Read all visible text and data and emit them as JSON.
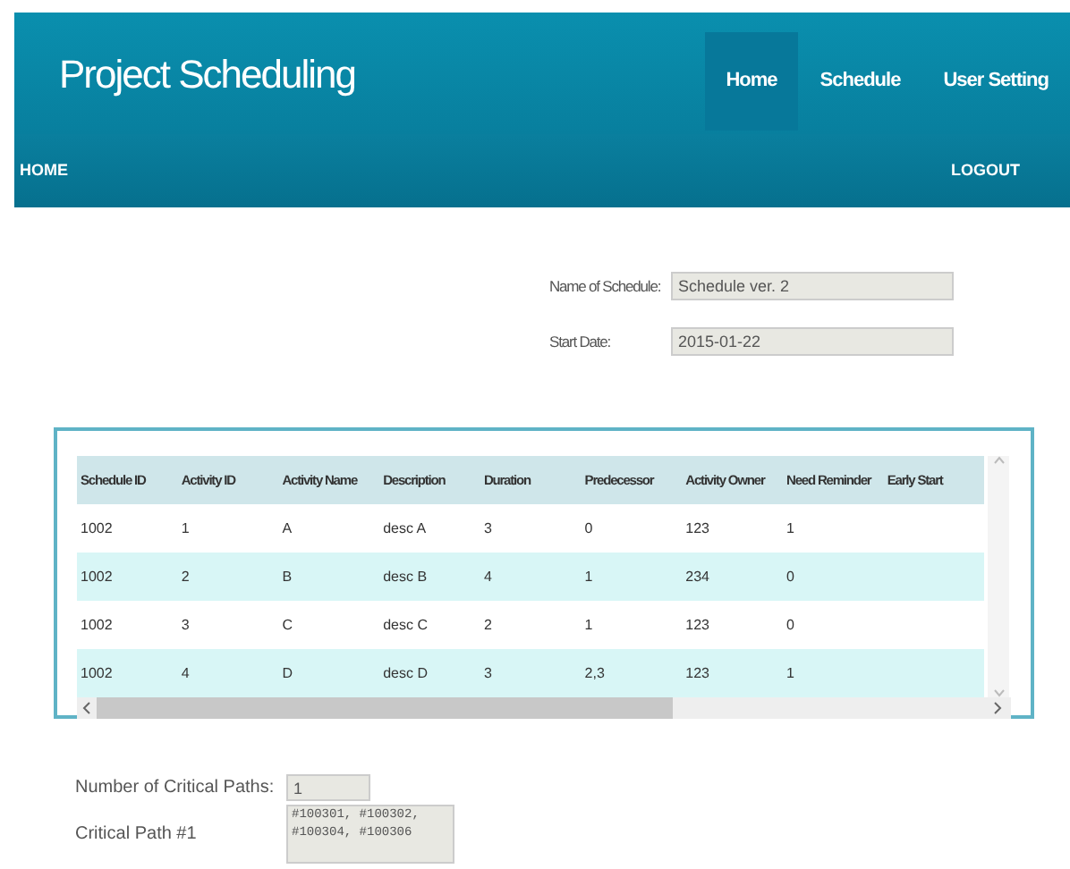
{
  "header": {
    "title": "Project Scheduling",
    "nav": [
      {
        "label": "Home",
        "selected": true
      },
      {
        "label": "Schedule",
        "selected": false
      },
      {
        "label": "User Setting",
        "selected": false
      }
    ]
  },
  "subbar": {
    "left": "HOME",
    "right": "LOGOUT"
  },
  "form": [
    {
      "label": "Name of Schedule:",
      "value": "Schedule ver. 2"
    },
    {
      "label": "Start Date:",
      "value": "2015-01-22"
    }
  ],
  "table": {
    "columns": [
      "Schedule ID",
      "Activity ID",
      "Activity Name",
      "Description",
      "Duration",
      "Predecessor",
      "Activity Owner",
      "Need Reminder",
      "Early Start"
    ],
    "rows": [
      [
        "1002",
        "1",
        "A",
        "desc A",
        "3",
        "0",
        "123",
        "1",
        ""
      ],
      [
        "1002",
        "2",
        "B",
        "desc B",
        "4",
        "1",
        "234",
        "0",
        ""
      ],
      [
        "1002",
        "3",
        "C",
        "desc C",
        "2",
        "1",
        "123",
        "0",
        ""
      ],
      [
        "1002",
        "4",
        "D",
        "desc D",
        "3",
        "2,3",
        "123",
        "1",
        ""
      ]
    ]
  },
  "critical": {
    "count_label": "Number of Critical Paths:",
    "count": "1",
    "path_label": "Critical Path #1",
    "path": "#100301, #100302,\n#100304, #100306"
  }
}
